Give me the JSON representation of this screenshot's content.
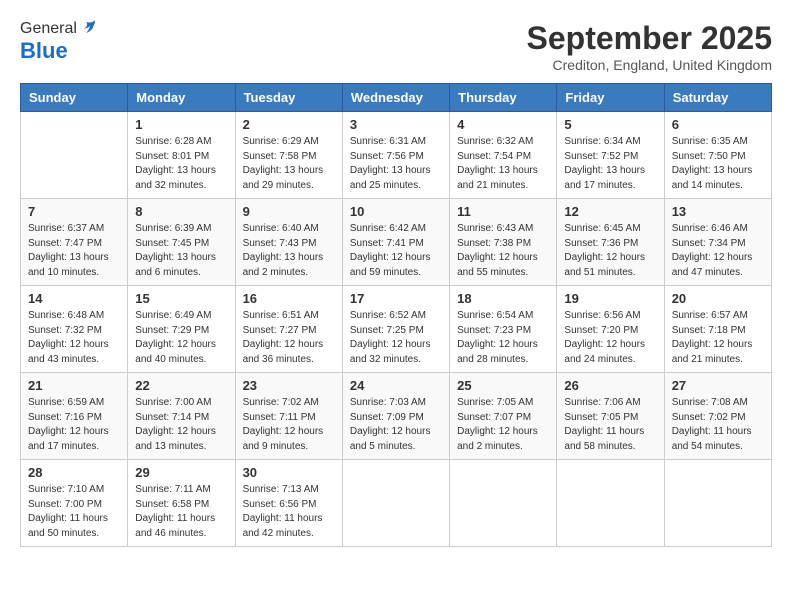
{
  "logo": {
    "general": "General",
    "blue": "Blue"
  },
  "header": {
    "month": "September 2025",
    "location": "Crediton, England, United Kingdom"
  },
  "weekdays": [
    "Sunday",
    "Monday",
    "Tuesday",
    "Wednesday",
    "Thursday",
    "Friday",
    "Saturday"
  ],
  "weeks": [
    [
      {
        "day": null
      },
      {
        "day": "1",
        "sunrise": "6:28 AM",
        "sunset": "8:01 PM",
        "daylight": "13 hours and 32 minutes."
      },
      {
        "day": "2",
        "sunrise": "6:29 AM",
        "sunset": "7:58 PM",
        "daylight": "13 hours and 29 minutes."
      },
      {
        "day": "3",
        "sunrise": "6:31 AM",
        "sunset": "7:56 PM",
        "daylight": "13 hours and 25 minutes."
      },
      {
        "day": "4",
        "sunrise": "6:32 AM",
        "sunset": "7:54 PM",
        "daylight": "13 hours and 21 minutes."
      },
      {
        "day": "5",
        "sunrise": "6:34 AM",
        "sunset": "7:52 PM",
        "daylight": "13 hours and 17 minutes."
      },
      {
        "day": "6",
        "sunrise": "6:35 AM",
        "sunset": "7:50 PM",
        "daylight": "13 hours and 14 minutes."
      }
    ],
    [
      {
        "day": "7",
        "sunrise": "6:37 AM",
        "sunset": "7:47 PM",
        "daylight": "13 hours and 10 minutes."
      },
      {
        "day": "8",
        "sunrise": "6:39 AM",
        "sunset": "7:45 PM",
        "daylight": "13 hours and 6 minutes."
      },
      {
        "day": "9",
        "sunrise": "6:40 AM",
        "sunset": "7:43 PM",
        "daylight": "13 hours and 2 minutes."
      },
      {
        "day": "10",
        "sunrise": "6:42 AM",
        "sunset": "7:41 PM",
        "daylight": "12 hours and 59 minutes."
      },
      {
        "day": "11",
        "sunrise": "6:43 AM",
        "sunset": "7:38 PM",
        "daylight": "12 hours and 55 minutes."
      },
      {
        "day": "12",
        "sunrise": "6:45 AM",
        "sunset": "7:36 PM",
        "daylight": "12 hours and 51 minutes."
      },
      {
        "day": "13",
        "sunrise": "6:46 AM",
        "sunset": "7:34 PM",
        "daylight": "12 hours and 47 minutes."
      }
    ],
    [
      {
        "day": "14",
        "sunrise": "6:48 AM",
        "sunset": "7:32 PM",
        "daylight": "12 hours and 43 minutes."
      },
      {
        "day": "15",
        "sunrise": "6:49 AM",
        "sunset": "7:29 PM",
        "daylight": "12 hours and 40 minutes."
      },
      {
        "day": "16",
        "sunrise": "6:51 AM",
        "sunset": "7:27 PM",
        "daylight": "12 hours and 36 minutes."
      },
      {
        "day": "17",
        "sunrise": "6:52 AM",
        "sunset": "7:25 PM",
        "daylight": "12 hours and 32 minutes."
      },
      {
        "day": "18",
        "sunrise": "6:54 AM",
        "sunset": "7:23 PM",
        "daylight": "12 hours and 28 minutes."
      },
      {
        "day": "19",
        "sunrise": "6:56 AM",
        "sunset": "7:20 PM",
        "daylight": "12 hours and 24 minutes."
      },
      {
        "day": "20",
        "sunrise": "6:57 AM",
        "sunset": "7:18 PM",
        "daylight": "12 hours and 21 minutes."
      }
    ],
    [
      {
        "day": "21",
        "sunrise": "6:59 AM",
        "sunset": "7:16 PM",
        "daylight": "12 hours and 17 minutes."
      },
      {
        "day": "22",
        "sunrise": "7:00 AM",
        "sunset": "7:14 PM",
        "daylight": "12 hours and 13 minutes."
      },
      {
        "day": "23",
        "sunrise": "7:02 AM",
        "sunset": "7:11 PM",
        "daylight": "12 hours and 9 minutes."
      },
      {
        "day": "24",
        "sunrise": "7:03 AM",
        "sunset": "7:09 PM",
        "daylight": "12 hours and 5 minutes."
      },
      {
        "day": "25",
        "sunrise": "7:05 AM",
        "sunset": "7:07 PM",
        "daylight": "12 hours and 2 minutes."
      },
      {
        "day": "26",
        "sunrise": "7:06 AM",
        "sunset": "7:05 PM",
        "daylight": "11 hours and 58 minutes."
      },
      {
        "day": "27",
        "sunrise": "7:08 AM",
        "sunset": "7:02 PM",
        "daylight": "11 hours and 54 minutes."
      }
    ],
    [
      {
        "day": "28",
        "sunrise": "7:10 AM",
        "sunset": "7:00 PM",
        "daylight": "11 hours and 50 minutes."
      },
      {
        "day": "29",
        "sunrise": "7:11 AM",
        "sunset": "6:58 PM",
        "daylight": "11 hours and 46 minutes."
      },
      {
        "day": "30",
        "sunrise": "7:13 AM",
        "sunset": "6:56 PM",
        "daylight": "11 hours and 42 minutes."
      },
      {
        "day": null
      },
      {
        "day": null
      },
      {
        "day": null
      },
      {
        "day": null
      }
    ]
  ],
  "labels": {
    "sunrise": "Sunrise:",
    "sunset": "Sunset:",
    "daylight": "Daylight hours"
  }
}
